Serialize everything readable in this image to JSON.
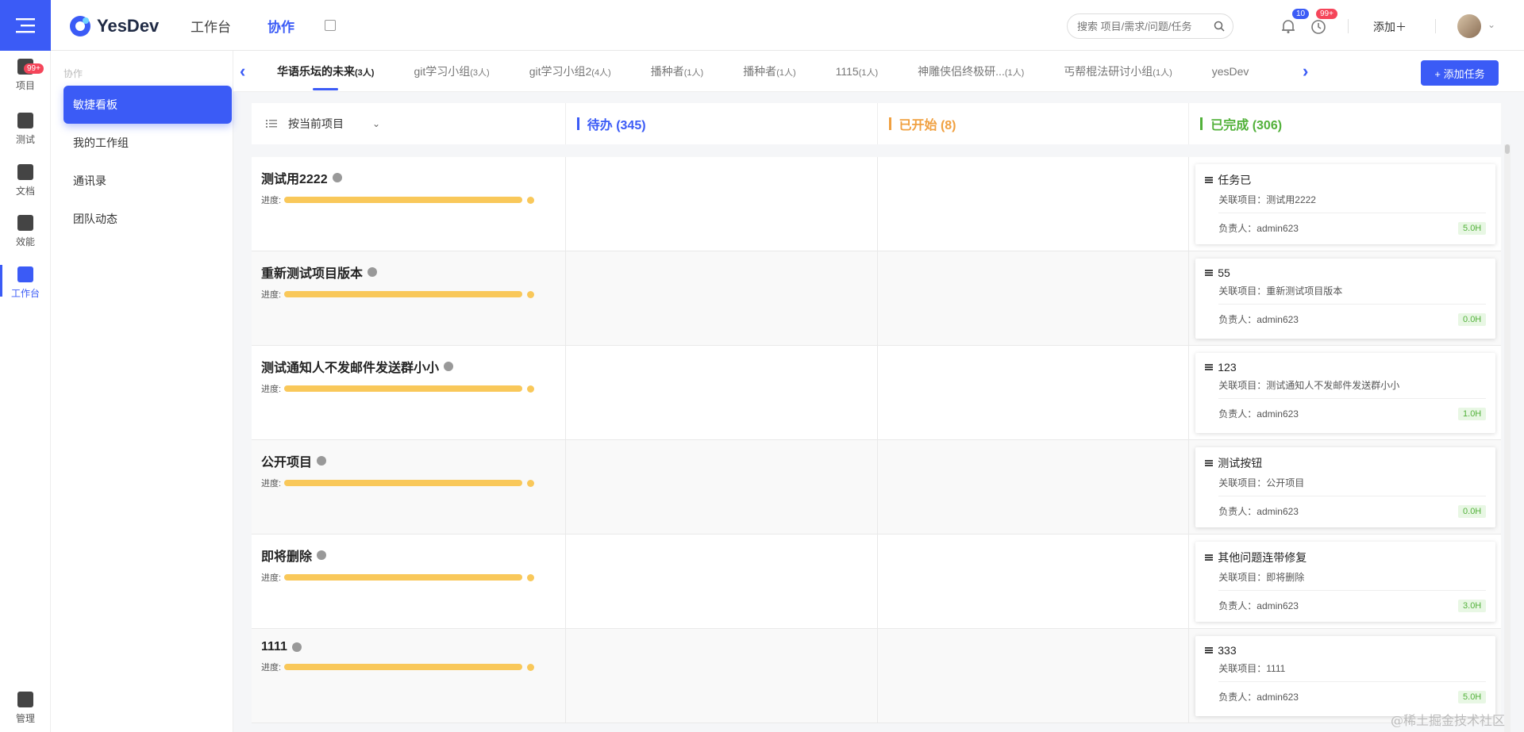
{
  "app": {
    "logo_text": "YesDev"
  },
  "topnav": [
    {
      "label": "工作台",
      "active": false
    },
    {
      "label": "协作",
      "active": true
    }
  ],
  "search": {
    "placeholder": "搜索 项目/需求/问题/任务"
  },
  "notifications": {
    "bell_count": "10",
    "clock_count": "99+"
  },
  "header": {
    "add_label": "添加＋"
  },
  "rail": [
    {
      "label": "项目",
      "icon": "box-icon",
      "badge": "99+",
      "active": false
    },
    {
      "label": "测试",
      "icon": "test-icon",
      "active": false
    },
    {
      "label": "文档",
      "icon": "doc-icon",
      "active": false
    },
    {
      "label": "效能",
      "icon": "chart-icon",
      "active": false
    },
    {
      "label": "工作台",
      "icon": "grid-icon",
      "active": true
    },
    {
      "label": "管理",
      "icon": "admin-icon",
      "active": false
    }
  ],
  "sidebar": {
    "caption": "协作",
    "items": [
      {
        "label": "敏捷看板",
        "active": true
      },
      {
        "label": "我的工作组",
        "active": false
      },
      {
        "label": "通讯录",
        "active": false
      },
      {
        "label": "团队动态",
        "active": false
      }
    ]
  },
  "tabs": [
    {
      "name": "华语乐坛的未来",
      "count": "(3人)",
      "active": true
    },
    {
      "name": "git学习小组",
      "count": "(3人)"
    },
    {
      "name": "git学习小组2",
      "count": "(4人)"
    },
    {
      "name": "播种者",
      "count": "(1人)"
    },
    {
      "name": "播种者",
      "count": "(1人)"
    },
    {
      "name": "1115",
      "count": "(1人)"
    },
    {
      "name": "神雕侠侣终极研...",
      "count": "(1人)"
    },
    {
      "name": "丐帮棍法研讨小组",
      "count": "(1人)"
    },
    {
      "name": "yesDev",
      "count": ""
    }
  ],
  "toolbar": {
    "add_task_label": "+ 添加任务"
  },
  "board": {
    "filter_label": "按当前项目",
    "columns": [
      {
        "label": "待办 (345)",
        "color": "#3b5bf6"
      },
      {
        "label": "已开始 (8)",
        "color": "#f0a040"
      },
      {
        "label": "已完成 (306)",
        "color": "#52b13a"
      }
    ],
    "progress_label": "进度:",
    "rows": [
      {
        "project": "测试用2222",
        "progress": 1.0,
        "done_card": {
          "title": "任务已",
          "related": "关联项目：测试用2222",
          "owner": "负责人：admin623",
          "hours": "5.0H"
        }
      },
      {
        "project": "重新测试项目版本",
        "progress": 1.0,
        "done_card": {
          "title": "55",
          "related": "关联项目：重新测试项目版本",
          "owner": "负责人：admin623",
          "hours": "0.0H"
        }
      },
      {
        "project": "测试通知人不发邮件发送群小小",
        "progress": 1.0,
        "done_card": {
          "title": "123",
          "related": "关联项目：测试通知人不发邮件发送群小小",
          "owner": "负责人：admin623",
          "hours": "1.0H"
        }
      },
      {
        "project": "公开项目",
        "progress": 1.0,
        "done_card": {
          "title": "测试按钮",
          "related": "关联项目：公开项目",
          "owner": "负责人：admin623",
          "hours": "0.0H"
        }
      },
      {
        "project": "即将删除",
        "progress": 1.0,
        "done_card": {
          "title": "其他问题连带修复",
          "related": "关联项目：即将删除",
          "owner": "负责人：admin623",
          "hours": "3.0H"
        }
      },
      {
        "project": "1111",
        "progress": 1.0,
        "done_card": {
          "title": "333",
          "related": "关联项目：1111",
          "owner": "负责人：admin623",
          "hours": "5.0H"
        }
      }
    ]
  },
  "watermark": "@稀土掘金技术社区"
}
